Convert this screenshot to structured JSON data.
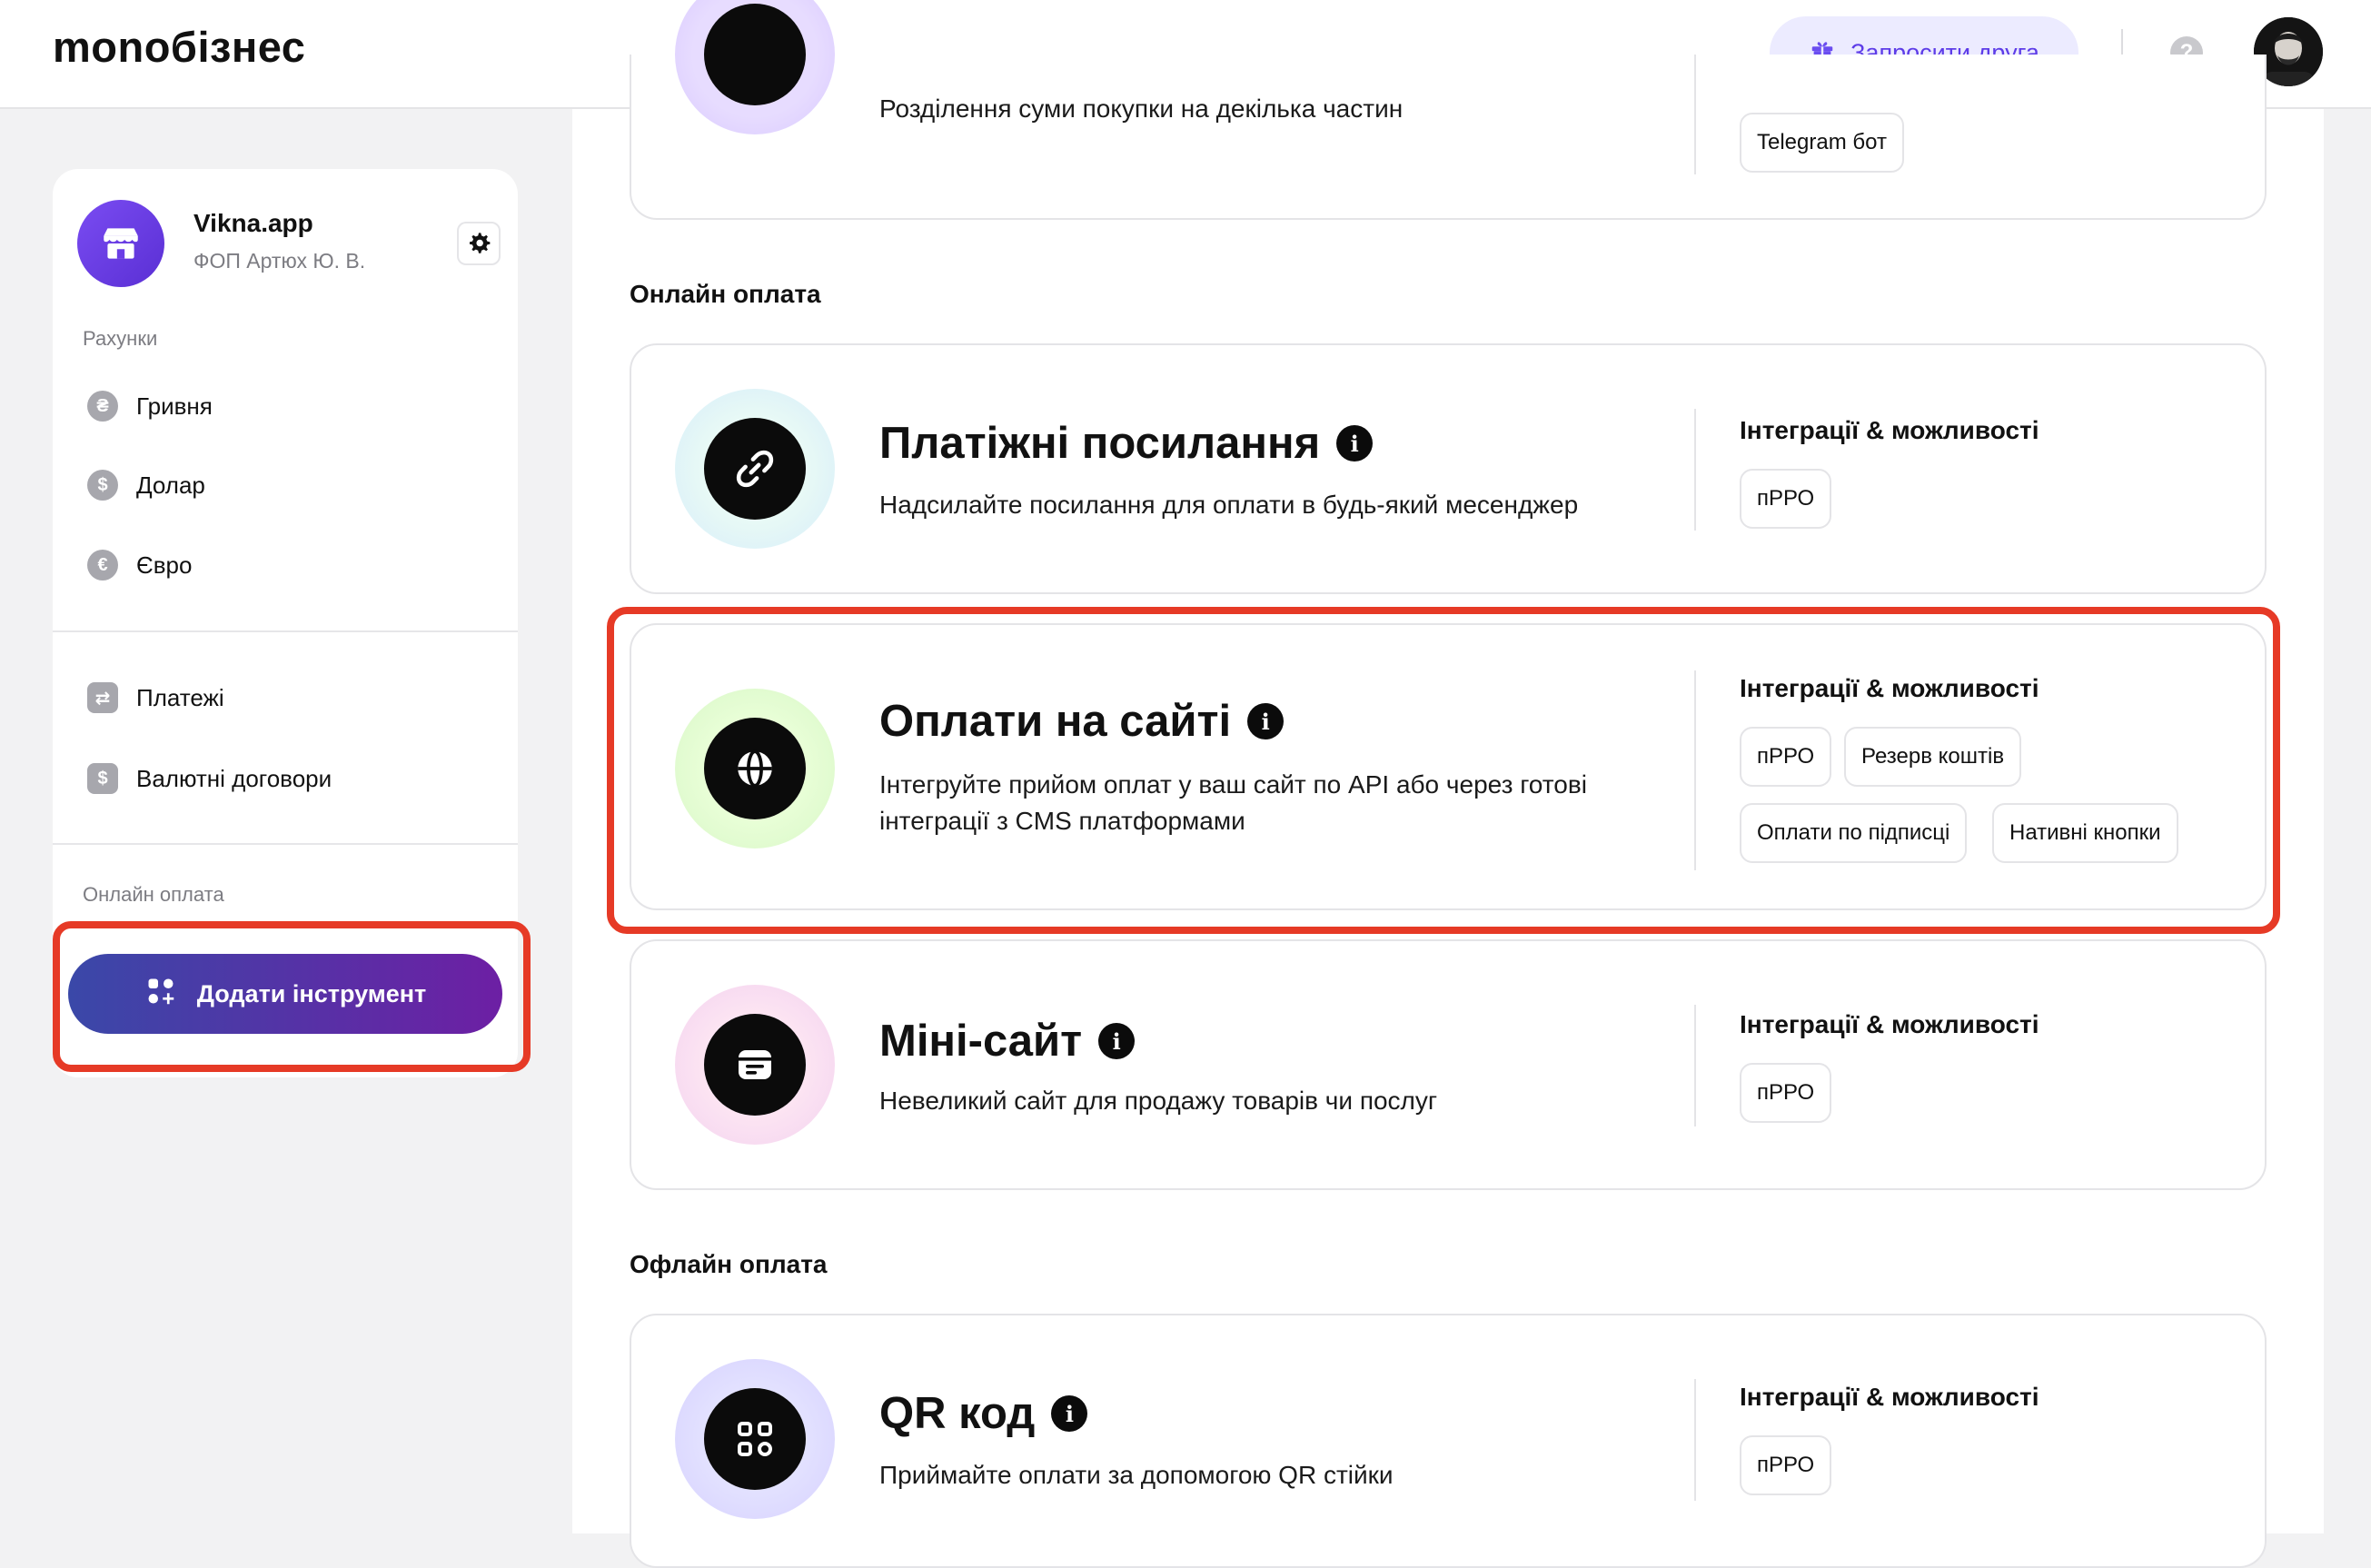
{
  "header": {
    "logo": "monoбізнес",
    "invite_label": "Запросити друга",
    "help_icon_label": "?"
  },
  "sidebar": {
    "account_name": "Vikna.app",
    "account_sub": "ФОП Артюх Ю. В.",
    "accounts_label": "Рахунки",
    "accounts": [
      {
        "symbol": "₴",
        "label": "Гривня"
      },
      {
        "symbol": "$",
        "label": "Долар"
      },
      {
        "symbol": "€",
        "label": "Євро"
      }
    ],
    "links": [
      {
        "symbol": "⇄",
        "label": "Платежі"
      },
      {
        "symbol": "$",
        "label": "Валютні договори"
      }
    ],
    "online_label": "Онлайн оплата",
    "add_tool_label": "Додати інструмент"
  },
  "main": {
    "top_card": {
      "desc": "Розділення суми покупки на декілька частин",
      "tag": "Telegram бот"
    },
    "section_online": "Онлайн оплата",
    "section_offline": "Офлайн оплата",
    "integrations_label": "Інтеграції & можливості",
    "cards": [
      {
        "title": "Платіжні посилання",
        "info": "i",
        "desc": "Надсилайте посилання для оплати в будь-який месенджер",
        "tags": [
          "пРРО"
        ]
      },
      {
        "title": "Оплати на сайті",
        "info": "i",
        "desc": "Інтегруйте прийом оплат у ваш сайт по API або через готові інтеграції з CMS платформами",
        "tags": [
          "пРРО",
          "Резерв коштів",
          "Оплати по підписці",
          "Нативні кнопки"
        ]
      },
      {
        "title": "Міні-сайт",
        "info": "i",
        "desc": "Невеликий сайт для продажу товарів чи послуг",
        "tags": [
          "пРРО"
        ]
      },
      {
        "title": "QR код",
        "info": "i",
        "desc": "Приймайте оплати за допомогою QR стійки",
        "tags": [
          "пРРО"
        ]
      }
    ]
  },
  "colors": {
    "accent": "#5d3ce8",
    "highlight": "#e63a26",
    "button_gradient_start": "#3a48a8",
    "button_gradient_end": "#6d1fa4"
  },
  "icons": [
    "gift-icon",
    "help-icon",
    "avatar",
    "store-icon",
    "gear-icon",
    "hryvnia-icon",
    "dollar-icon",
    "euro-icon",
    "transfer-icon",
    "contract-icon",
    "add-tool-icon",
    "link-icon",
    "globe-icon",
    "minisite-icon",
    "qr-icon",
    "info-icon"
  ]
}
